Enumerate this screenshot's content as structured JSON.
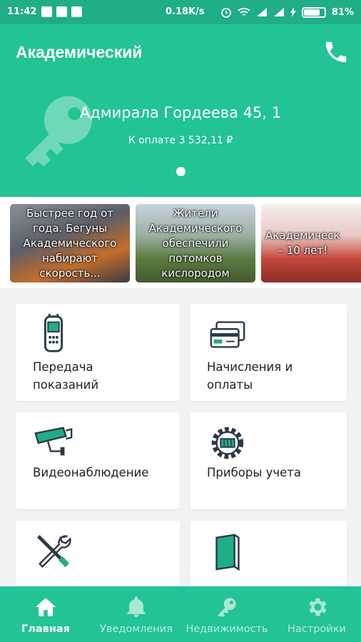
{
  "status_bar": {
    "time": "11:42",
    "speed": "0.18K/s",
    "battery": "81%",
    "battery_level": 0.81
  },
  "app_bar": {
    "title": "Академический",
    "phone_icon": "phone-icon"
  },
  "hero": {
    "address": "Адмирала Гордеева 45, 1",
    "payment": "К оплате 3 532,11 ₽",
    "key_icon": "key-icon"
  },
  "news": [
    {
      "caption": "Быстрее год от года. Бегуны Академического набирают скорость..."
    },
    {
      "caption": "Жители Академического обеспечили потомков кислородом"
    },
    {
      "caption": "Академическ\n– 10 лет!"
    }
  ],
  "tiles": [
    {
      "label": "Передача\nпоказаний",
      "icon": "meter-device-icon"
    },
    {
      "label": "Начисления и\nоплаты",
      "icon": "credit-cards-icon"
    },
    {
      "label": "Видеонаблюдение",
      "icon": "security-camera-icon"
    },
    {
      "label": "Приборы учета",
      "icon": "gear-meter-icon"
    },
    {
      "label": "",
      "icon": "tools-icon"
    },
    {
      "label": "",
      "icon": "document-icon"
    }
  ],
  "bottom_nav": [
    {
      "label": "Главная",
      "icon": "home-icon",
      "active": true
    },
    {
      "label": "Уведомления",
      "icon": "bell-icon",
      "active": false
    },
    {
      "label": "Недвижимость",
      "icon": "key-icon",
      "active": false
    },
    {
      "label": "Настройки",
      "icon": "gear-icon",
      "active": false
    }
  ],
  "colors": {
    "primary": "#22c394",
    "status_bar": "#1fae85",
    "icon_dark": "#2b3a4a",
    "icon_accent": "#1fae85"
  }
}
